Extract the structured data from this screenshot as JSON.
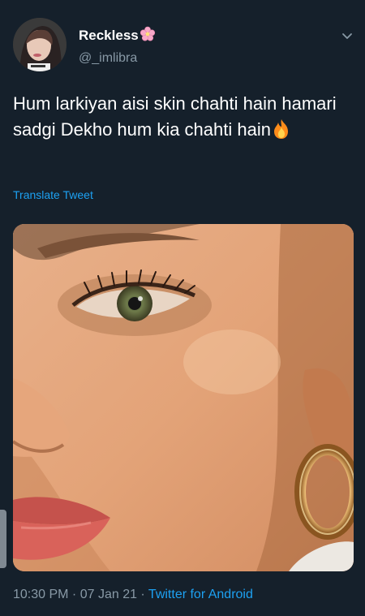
{
  "tweet": {
    "author": {
      "display_name": "Reckless",
      "handle": "@_imlibra",
      "name_emoji": "cherry-blossom-icon"
    },
    "text": "Hum larkiyan aisi skin chahti hain hamari sadgi Dekho hum kia chahti hain",
    "text_emoji": "fire-icon",
    "translate_label": "Translate Tweet",
    "timestamp": "10:30 PM · 07 Jan 21 · ",
    "source": "Twitter for Android"
  },
  "colors": {
    "background": "#15202b",
    "secondary_text": "#8899a6",
    "accent": "#1da1f2"
  }
}
